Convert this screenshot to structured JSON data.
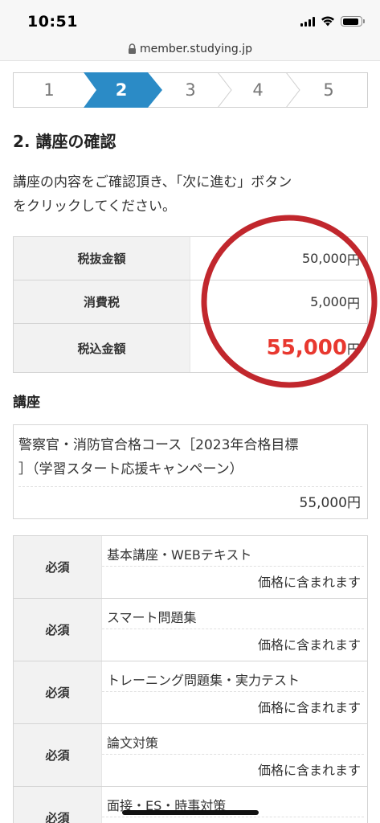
{
  "status_bar": {
    "time": "10:51",
    "signal_icon": "cellular-signal-icon",
    "wifi_icon": "wifi-icon",
    "battery_icon": "battery-icon"
  },
  "browser": {
    "url": "member.studying.jp",
    "lock_icon": "lock-icon"
  },
  "steps": {
    "items": [
      "1",
      "2",
      "3",
      "4",
      "5"
    ],
    "active_index": 1,
    "active_color": "#2b8bc6"
  },
  "section": {
    "title": "2. 講座の確認",
    "intro_line1": "講座の内容をご確認頂き、「次に進む」ボタン",
    "intro_line2": "をクリックしてください。"
  },
  "price_table": {
    "rows": [
      {
        "label": "税抜金額",
        "amount": "50,000",
        "unit": "円"
      },
      {
        "label": "消費税",
        "amount": "5,000",
        "unit": "円"
      },
      {
        "label": "税込金額",
        "amount": "55,000",
        "unit": "円"
      }
    ],
    "total_color": "#e8382f",
    "highlight_circle_color": "#c1272d"
  },
  "course": {
    "heading": "講座",
    "name_line1": "警察官・消防官合格コース［2023年合格目標",
    "name_line2": "］（学習スタート応援キャンペーン）",
    "price": "55,000円"
  },
  "requirements": {
    "rows": [
      {
        "tag": "必須",
        "name": "基本講座・WEBテキスト",
        "price": "価格に含まれます"
      },
      {
        "tag": "必須",
        "name": "スマート問題集",
        "price": "価格に含まれます"
      },
      {
        "tag": "必須",
        "name": "トレーニング問題集・実力テスト",
        "price": "価格に含まれます"
      },
      {
        "tag": "必須",
        "name": "論文対策",
        "price": "価格に含まれます"
      },
      {
        "tag": "必須",
        "name": "面接・ES・時事対策",
        "price": ""
      }
    ]
  }
}
